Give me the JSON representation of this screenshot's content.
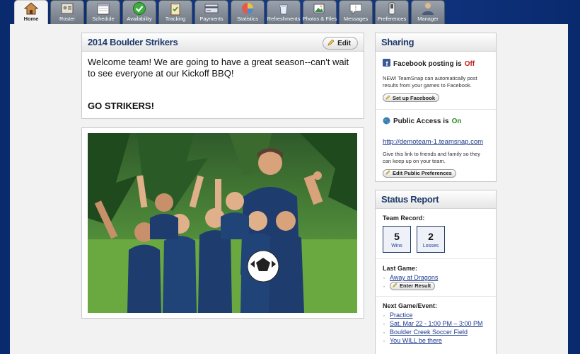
{
  "tabs": [
    {
      "label": "Home",
      "icon": "house-icon",
      "active": true
    },
    {
      "label": "Roster",
      "icon": "roster-icon",
      "active": false
    },
    {
      "label": "Schedule",
      "icon": "calendar-icon",
      "active": false
    },
    {
      "label": "Availability",
      "icon": "checkmark-icon",
      "active": false
    },
    {
      "label": "Tracking",
      "icon": "clipboard-icon",
      "active": false
    },
    {
      "label": "Payments",
      "icon": "payment-icon",
      "active": false
    },
    {
      "label": "Statistics",
      "icon": "pie-chart-icon",
      "active": false
    },
    {
      "label": "Refreshments",
      "icon": "cup-icon",
      "active": false
    },
    {
      "label": "Photos & Files",
      "icon": "photos-icon",
      "active": false
    },
    {
      "label": "Messages",
      "icon": "speech-bubble-icon",
      "active": false
    },
    {
      "label": "Preferences",
      "icon": "switch-icon",
      "active": false
    },
    {
      "label": "Manager",
      "icon": "person-icon",
      "active": false
    }
  ],
  "welcome": {
    "title": "2014 Boulder Strikers",
    "edit_label": "Edit",
    "message": "Welcome team! We are going to have a great season--can't wait to see everyone at our Kickoff BBQ!",
    "slogan": "GO STRIKERS!"
  },
  "sharing": {
    "title": "Sharing",
    "facebook_label": "Facebook posting is",
    "facebook_status": "Off",
    "facebook_desc": "NEW! TeamSnap can automatically post results from your games to Facebook.",
    "facebook_button": "Set up Facebook",
    "public_label": "Public Access is",
    "public_status": "On",
    "public_url": "http://demoteam-1.teamsnap.com",
    "public_desc": "Give this link to friends and family so they can keep up on your team.",
    "public_button": "Edit Public Preferences"
  },
  "status": {
    "title": "Status Report",
    "record_label": "Team Record:",
    "wins": "5",
    "wins_label": "Wins",
    "losses": "2",
    "losses_label": "Losses",
    "last_game_label": "Last Game:",
    "last_game": "Away at Dragons",
    "enter_result": "Enter Result",
    "next_label": "Next Game/Event:",
    "next_items": [
      "Practice",
      "Sat, Mar 22 - 1:00 PM – 3:00 PM",
      "Boulder Creek Soccer Field",
      "You WILL be there"
    ]
  },
  "colors": {
    "background": "#0a2a6e",
    "heading": "#1f3a6b",
    "off": "#c02020",
    "on": "#2a8a2a",
    "link": "#1c3a8f"
  }
}
